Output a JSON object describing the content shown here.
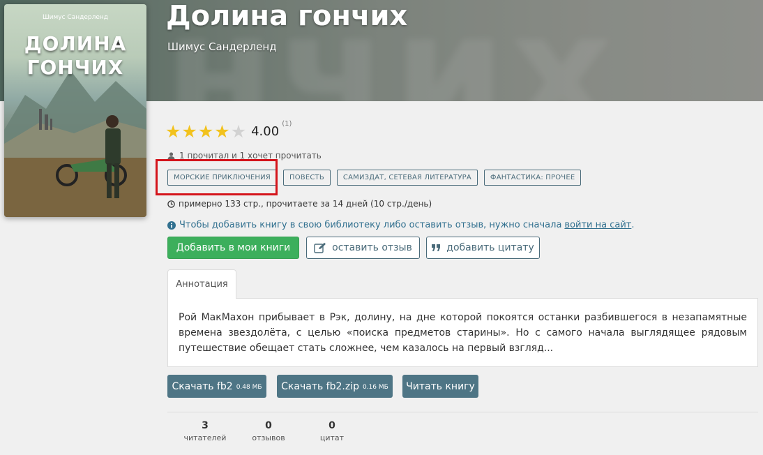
{
  "book": {
    "title": "Долина гончих",
    "author": "Шимус Сандерленд",
    "cover_author": "Шимус Сандерленд",
    "cover_title_line1": "ДОЛИНА",
    "cover_title_line2": "ГОНЧИХ",
    "hero_bg_text": "нчих"
  },
  "rating": {
    "value": "4.00",
    "count": "(1)",
    "stars_filled": 4,
    "stars_total": 5
  },
  "readers_text": "1 прочитал и 1 хочет прочитать",
  "tags": [
    {
      "label": "МОРСКИЕ ПРИКЛЮЧЕНИЯ"
    },
    {
      "label": "ПОВЕСТЬ"
    },
    {
      "label": "САМИЗДАТ, СЕТЕВАЯ ЛИТЕРАТУРА"
    },
    {
      "label": "ФАНТАСТИКА: ПРОЧЕЕ"
    }
  ],
  "pages_text": "примерно 133 стр., прочитаете за 14 дней (10 стр./день)",
  "notice": {
    "text": "Чтобы добавить книгу в свою библиотеку либо оставить отзыв, нужно сначала",
    "link": "войти на сайт",
    "end": "."
  },
  "actions": {
    "add": "Добавить в мои книги",
    "review": "оставить отзыв",
    "quote": "добавить цитату"
  },
  "annotation": {
    "tab_label": "Аннотация",
    "text": "Рой МакМахон прибывает в Рэк, долину, на дне которой покоятся останки разбившегося в незапамятные времена звездолёта, с целью «поиска предметов старины». Но с самого начала выглядящее рядовым путешествие обещает стать сложнее, чем казалось на первый взгляд..."
  },
  "downloads": {
    "fb2_label": "Скачать fb2",
    "fb2_size": "0.48 МБ",
    "zip_label": "Скачать fb2.zip",
    "zip_size": "0.16 МБ",
    "read_label": "Читать книгу"
  },
  "stats": [
    {
      "num": "3",
      "label": "читателей"
    },
    {
      "num": "0",
      "label": "отзывов"
    },
    {
      "num": "0",
      "label": "цитат"
    }
  ],
  "colors": {
    "accent_green": "#3caf5c",
    "tag_border": "#4a6b7a",
    "button_dark": "#4e7585",
    "star": "#f2c21d",
    "highlight": "#d4141b",
    "notice": "#31708f"
  }
}
